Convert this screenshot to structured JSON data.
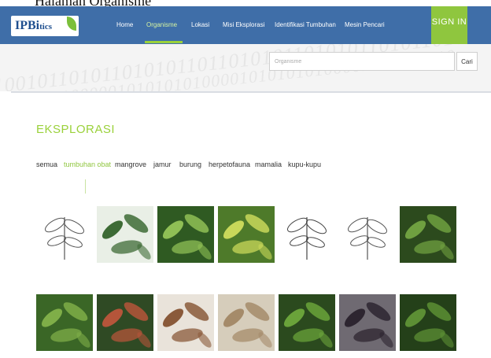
{
  "caption": "Halaman Organisme",
  "navbar": {
    "logo_text": "IPBi",
    "logo_suffix": "tics",
    "items": [
      {
        "label": "Home"
      },
      {
        "label": "Organisme"
      },
      {
        "label": "Lokasi"
      },
      {
        "label": "Misi Eksplorasi"
      },
      {
        "label": "Identifikasi Tumbuhan"
      },
      {
        "label": "Mesin Pencari"
      }
    ],
    "active_item": "Organisme",
    "signin_label": "SIGN IN"
  },
  "hero": {
    "bits_line_1": "1001011010110101011011010101101010110101101010",
    "bits_line_2": "010100000101010101000010101010100001010101010"
  },
  "search": {
    "placeholder": "Organisme",
    "button_label": "Cari"
  },
  "section": {
    "title": "EKSPLORASI"
  },
  "filters": [
    {
      "label": "semua"
    },
    {
      "label": "tumbuhan obat"
    },
    {
      "label": "mangrove"
    },
    {
      "label": "jamur"
    },
    {
      "label": "burung"
    },
    {
      "label": "herpetofauna"
    },
    {
      "label": "mamalia"
    },
    {
      "label": "kupu-kupu"
    }
  ],
  "active_filter": "tumbuhan obat",
  "gallery": [
    {
      "icon": "botanical-sketch-icon",
      "colors": [
        "#ffffff",
        "#555555"
      ]
    },
    {
      "icon": "large-leaves-icon",
      "colors": [
        "#e9efe6",
        "#3d6b35"
      ]
    },
    {
      "icon": "grass-shrub-icon",
      "colors": [
        "#2f5a22",
        "#8fbf55"
      ]
    },
    {
      "icon": "yellow-leaves-icon",
      "colors": [
        "#4e7a2a",
        "#c9d85a"
      ]
    },
    {
      "icon": "flower-sketch-icon",
      "colors": [
        "#ffffff",
        "#444444"
      ]
    },
    {
      "icon": "leaf-sketch-icon",
      "colors": [
        "#ffffff",
        "#555555"
      ]
    },
    {
      "icon": "vine-photo-icon",
      "colors": [
        "#2c4a1d",
        "#6fa040"
      ]
    },
    {
      "icon": "ground-cover-icon",
      "colors": [
        "#3a6626",
        "#7fae48"
      ]
    },
    {
      "icon": "red-leaves-icon",
      "colors": [
        "#2f4a24",
        "#b5553a"
      ]
    },
    {
      "icon": "brown-leaf-icon",
      "colors": [
        "#e9e3da",
        "#8a5a3a"
      ]
    },
    {
      "icon": "pale-leaves-icon",
      "colors": [
        "#d6cdbb",
        "#a58b6a"
      ]
    },
    {
      "icon": "green-shoot-icon",
      "colors": [
        "#2b4a1e",
        "#6aa33a"
      ]
    },
    {
      "icon": "dark-leaves-icon",
      "colors": [
        "#6f6a72",
        "#2d2530"
      ]
    },
    {
      "icon": "forest-plant-icon",
      "colors": [
        "#244019",
        "#5c8f34"
      ]
    }
  ]
}
